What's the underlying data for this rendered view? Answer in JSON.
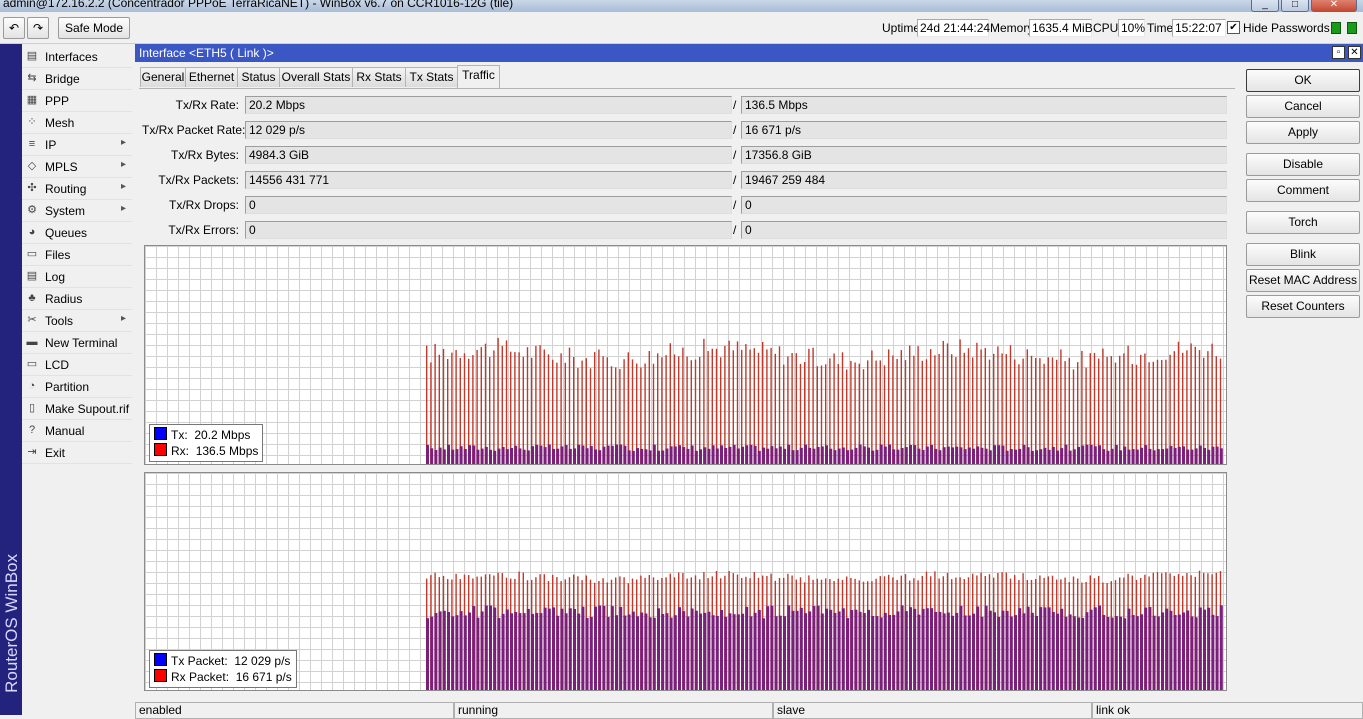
{
  "titlebar": {
    "title": "admin@172.16.2.2 (Concentrador PPPoE TerraRicaNET) - WinBox v6.7 on CCR1016-12G (tile)"
  },
  "toolbar": {
    "undo_icon": "undo-icon",
    "redo_icon": "redo-icon",
    "safe_mode_label": "Safe Mode",
    "uptime_label": "Uptime:",
    "uptime_value": "24d 21:44:24",
    "memory_label": "Memory:",
    "memory_value": "1635.4 MiB",
    "cpu_label": "CPU:",
    "cpu_value": "10%",
    "time_label": "Time:",
    "time_value": "15:22:07",
    "hide_passwords_label": "Hide Passwords",
    "hide_passwords_checked": true
  },
  "brand": "RouterOS WinBox",
  "sidebar": {
    "items": [
      {
        "label": "Interfaces",
        "icon": "interfaces-icon",
        "submenu": false
      },
      {
        "label": "Bridge",
        "icon": "bridge-icon",
        "submenu": false
      },
      {
        "label": "PPP",
        "icon": "ppp-icon",
        "submenu": false
      },
      {
        "label": "Mesh",
        "icon": "mesh-icon",
        "submenu": false
      },
      {
        "label": "IP",
        "icon": "ip-icon",
        "submenu": true
      },
      {
        "label": "MPLS",
        "icon": "mpls-icon",
        "submenu": true
      },
      {
        "label": "Routing",
        "icon": "routing-icon",
        "submenu": true
      },
      {
        "label": "System",
        "icon": "system-icon",
        "submenu": true
      },
      {
        "label": "Queues",
        "icon": "queues-icon",
        "submenu": false
      },
      {
        "label": "Files",
        "icon": "files-icon",
        "submenu": false
      },
      {
        "label": "Log",
        "icon": "log-icon",
        "submenu": false
      },
      {
        "label": "Radius",
        "icon": "radius-icon",
        "submenu": false
      },
      {
        "label": "Tools",
        "icon": "tools-icon",
        "submenu": true
      },
      {
        "label": "New Terminal",
        "icon": "terminal-icon",
        "submenu": false
      },
      {
        "label": "LCD",
        "icon": "lcd-icon",
        "submenu": false
      },
      {
        "label": "Partition",
        "icon": "partition-icon",
        "submenu": false
      },
      {
        "label": "Make Supout.rif",
        "icon": "supout-icon",
        "submenu": false
      },
      {
        "label": "Manual",
        "icon": "manual-icon",
        "submenu": false
      },
      {
        "label": "Exit",
        "icon": "exit-icon",
        "submenu": false
      }
    ]
  },
  "window": {
    "title": "Interface <ETH5 ( Link )>",
    "tabs": [
      {
        "label": "General",
        "active": false
      },
      {
        "label": "Ethernet",
        "active": false
      },
      {
        "label": "Status",
        "active": false
      },
      {
        "label": "Overall Stats",
        "active": false
      },
      {
        "label": "Rx Stats",
        "active": false
      },
      {
        "label": "Tx Stats",
        "active": false
      },
      {
        "label": "Traffic",
        "active": true
      }
    ],
    "fields": [
      {
        "label": "Tx/Rx Rate:",
        "tx": "20.2 Mbps",
        "rx": "136.5 Mbps"
      },
      {
        "label": "Tx/Rx Packet Rate:",
        "tx": "12 029 p/s",
        "rx": "16 671 p/s"
      },
      {
        "label": "Tx/Rx Bytes:",
        "tx": "4984.3 GiB",
        "rx": "17356.8 GiB"
      },
      {
        "label": "Tx/Rx Packets:",
        "tx": "14556 431 771",
        "rx": "19467 259 484"
      },
      {
        "label": "Tx/Rx Drops:",
        "tx": "0",
        "rx": "0"
      },
      {
        "label": "Tx/Rx Errors:",
        "tx": "0",
        "rx": "0"
      }
    ],
    "separator": "/",
    "buttons": [
      "OK",
      "Cancel",
      "Apply",
      "Disable",
      "Comment",
      "Torch",
      "Blink",
      "Reset MAC Address",
      "Reset Counters"
    ],
    "status": [
      "enabled",
      "running",
      "slave",
      "link ok"
    ]
  },
  "colors": {
    "tx": "#0000ff",
    "rx": "#ff0000",
    "rx_bar": "#c0392b",
    "overlap": "#7a1f7a"
  },
  "chart_data": [
    {
      "type": "bar",
      "series": [
        {
          "name": "Tx",
          "current": "20.2 Mbps",
          "color": "#0000ff"
        },
        {
          "name": "Rx",
          "current": "136.5 Mbps",
          "color": "#ff0000"
        }
      ],
      "history_start_fraction": 0.26,
      "rx_level_fraction_range": [
        0.43,
        0.58
      ],
      "tx_level_fraction_range": [
        0.06,
        0.09
      ],
      "grid": true,
      "legend": "bottom-left"
    },
    {
      "type": "bar",
      "series": [
        {
          "name": "Tx Packet",
          "current": "12 029 p/s",
          "color": "#0000ff"
        },
        {
          "name": "Rx Packet",
          "current": "16 671 p/s",
          "color": "#ff0000"
        }
      ],
      "history_start_fraction": 0.26,
      "rx_level_fraction_range": [
        0.49,
        0.55
      ],
      "tx_level_fraction_range": [
        0.33,
        0.39
      ],
      "grid": true,
      "legend": "bottom-left"
    }
  ]
}
